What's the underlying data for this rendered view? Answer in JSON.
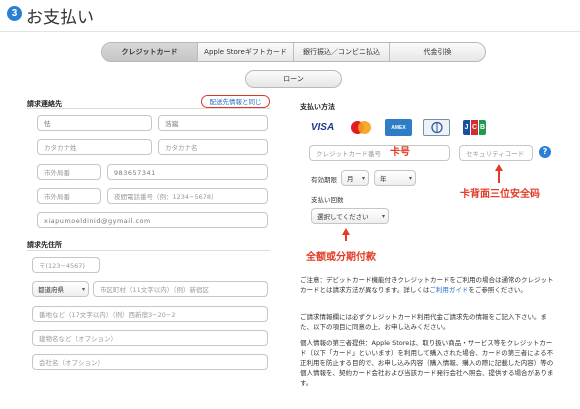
{
  "header": {
    "step_number": "3",
    "title": "お支払い"
  },
  "tabs": [
    {
      "label": "クレジットカード",
      "active": true
    },
    {
      "label": "Apple Storeギフトカード",
      "active": false
    },
    {
      "label": "銀行振込／コンビニ払込",
      "active": false
    },
    {
      "label": "代金引換",
      "active": false
    }
  ],
  "loan_label": "ローン",
  "billing_contact": {
    "heading": "請求連絡先",
    "same_as_shipping_link": "配送先情報と同じ",
    "last_name": "怯",
    "first_name": "浩蹴",
    "last_name_kana_placeholder": "カタカナ姓",
    "first_name_kana_placeholder": "カタカナ名",
    "area_code_1": "市外局番",
    "phone_1": "983657341",
    "area_code_2": "市外局番",
    "phone_2_placeholder": "夜間電話番号（例：1234−5678）",
    "email": "xiapumoeldinid@gymail.com"
  },
  "billing_address": {
    "heading": "請求先住所",
    "postal_placeholder": "〒(123−4567)",
    "prefecture_select": "都道府県",
    "city_placeholder": "市区町村（11文字以内）（例）新宿区",
    "street_placeholder": "番地など（17文字以内）（例）西新宿3−20−2",
    "building_placeholder": "建物名など（オプション）",
    "company_placeholder": "会社名（オプション）"
  },
  "payment": {
    "heading": "支払い方法",
    "card_logos": [
      "VISA",
      "MasterCard",
      "AMERICAN EXPRESS",
      "Diners Club",
      "JCB"
    ],
    "card_number_placeholder": "クレジットカード番号",
    "security_code_placeholder": "セキュリティコード",
    "help_icon": "?",
    "expiry_label": "有効期限",
    "month_select": "月",
    "year_select": "年",
    "installments_label": "支払い回数",
    "installments_select": "選択してください"
  },
  "annotations": {
    "card_number": "卡号",
    "security_code": "卡背面三位安全码",
    "installments": "全额或分期付款",
    "color": "#e23b26"
  },
  "notes": {
    "note1_pre": "ご注意：デビットカード機能付きクレジットカードをご利用の場合は通常のクレジットカードとは請求方法が異なります。詳しくは",
    "note1_link": "ご利用ガイド",
    "note1_post": "をご参照ください。",
    "note2": "ご請求情報欄には必ずクレジットカード利用代金ご請求先の情報をご記入下さい。また、以下の項目に同意の上、お申し込みください。",
    "note3": "個人情報の第三者提供：Apple Storeは、取り扱い商品・サービス等をクレジットカード（以下「カード」といいます）を利用して購入された場合、カードの第三者による不正利用を防止する目的で、お申し込み内容（購入情報、購入の際に記載した内容）等の個人情報を、契約カード会社および当該カード発行会社へ照会、提供する場合があります。"
  }
}
